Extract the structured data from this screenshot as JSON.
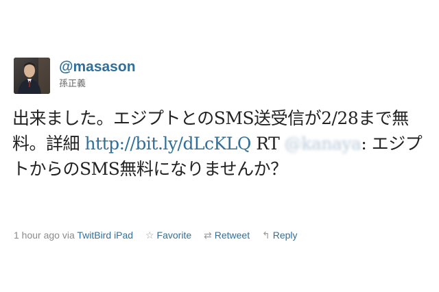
{
  "user": {
    "screen_name": "@masason",
    "full_name": "孫正義",
    "avatar_icon": "user-avatar"
  },
  "tweet": {
    "text_part1": "出来ました。エジプトとのSMS送受信が2/28まで無料。詳細 ",
    "link": "http://bit.ly/dLcKLQ",
    "text_part2": " RT ",
    "mention": "@kanaya",
    "text_part3": ": エジプトからのSMS無料になりませんか？"
  },
  "meta": {
    "time": "1 hour ago",
    "via_label": " via ",
    "client": "TwitBird iPad"
  },
  "actions": {
    "favorite": {
      "label": "Favorite",
      "icon": "star-icon"
    },
    "retweet": {
      "label": "Retweet",
      "icon": "retweet-icon"
    },
    "reply": {
      "label": "Reply",
      "icon": "reply-arrow-icon"
    }
  },
  "colors": {
    "link": "#2f6f9a",
    "meta_text": "#8a8a8a"
  }
}
